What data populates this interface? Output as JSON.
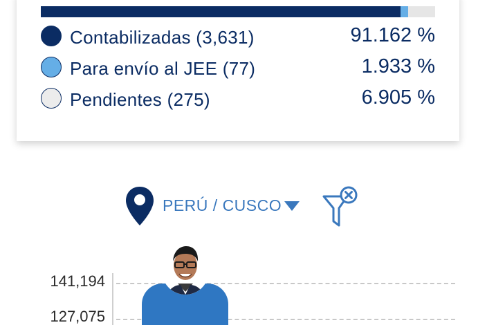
{
  "progress": {
    "segments": [
      {
        "name": "contabilizadas",
        "percent": 91.162,
        "color": "#0b2c63"
      },
      {
        "name": "para-envio-jee",
        "percent": 1.933,
        "color": "#65aee6"
      },
      {
        "name": "pendientes",
        "percent": 6.905,
        "color": "#e6e6e6"
      }
    ]
  },
  "legend": [
    {
      "label": "Contabilizadas (3,631)",
      "pct": "91.162 %",
      "color": "#0b2c63"
    },
    {
      "label": "Para envío al JEE (77)",
      "pct": "1.933 %",
      "color": "#65aee6"
    },
    {
      "label": "Pendientes (275)",
      "pct": "6.905 %",
      "color": "#ececec"
    }
  ],
  "location": {
    "label": "PERÚ / CUSCO",
    "icon": "map-pin-icon",
    "caret_icon": "caret-down-icon"
  },
  "filter": {
    "icon": "filter-clear-icon"
  },
  "chart": {
    "ticks": [
      "141,194",
      "127,075"
    ],
    "bar_color": "#2f77c2"
  }
}
